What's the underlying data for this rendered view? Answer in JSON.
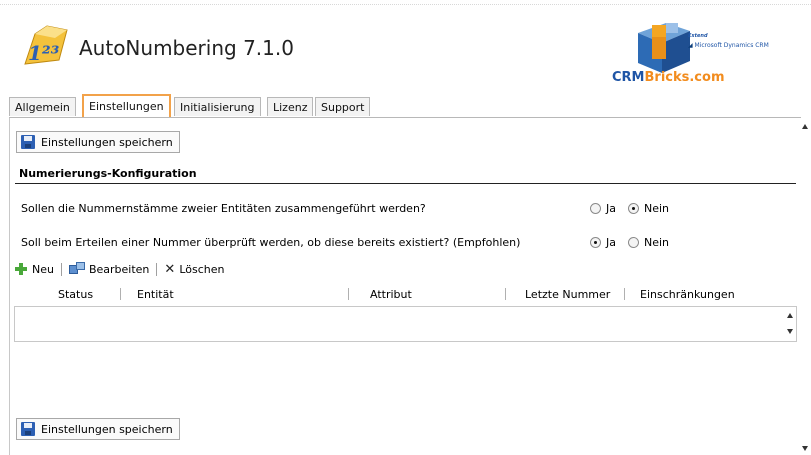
{
  "app": {
    "title": "AutoNumbering 7.1.0"
  },
  "brand": {
    "extend": "Extend",
    "dynamics": "Microsoft Dynamics CRM",
    "crm": "CRM",
    "bricks": "Bricks.com",
    "colors": {
      "crm": "#1f55a6",
      "bricks": "#f28c1e"
    }
  },
  "tabs": [
    {
      "label": "Allgemein"
    },
    {
      "label": "Einstellungen",
      "active": true
    },
    {
      "label": "Initialisierung"
    },
    {
      "label": "Lizenz"
    },
    {
      "label": "Support"
    }
  ],
  "buttons": {
    "save_top": "Einstellungen speichern",
    "save_bottom": "Einstellungen speichern"
  },
  "section": {
    "title": "Numerierungs-Konfiguration"
  },
  "questions": [
    {
      "text": "Sollen die Nummernstämme zweier Entitäten zusammengeführt werden?",
      "yes": "Ja",
      "no": "Nein",
      "selected": "Nein"
    },
    {
      "text": "Soll beim Erteilen einer Nummer überprüft werden, ob diese bereits existiert? (Empfohlen)",
      "yes": "Ja",
      "no": "Nein",
      "selected": "Ja"
    }
  ],
  "toolbar": {
    "new": "Neu",
    "edit": "Bearbeiten",
    "delete": "Löschen"
  },
  "grid": {
    "columns": [
      "Status",
      "Entität",
      "Attribut",
      "Letzte Nummer",
      "Einschränkungen"
    ],
    "rows": []
  }
}
